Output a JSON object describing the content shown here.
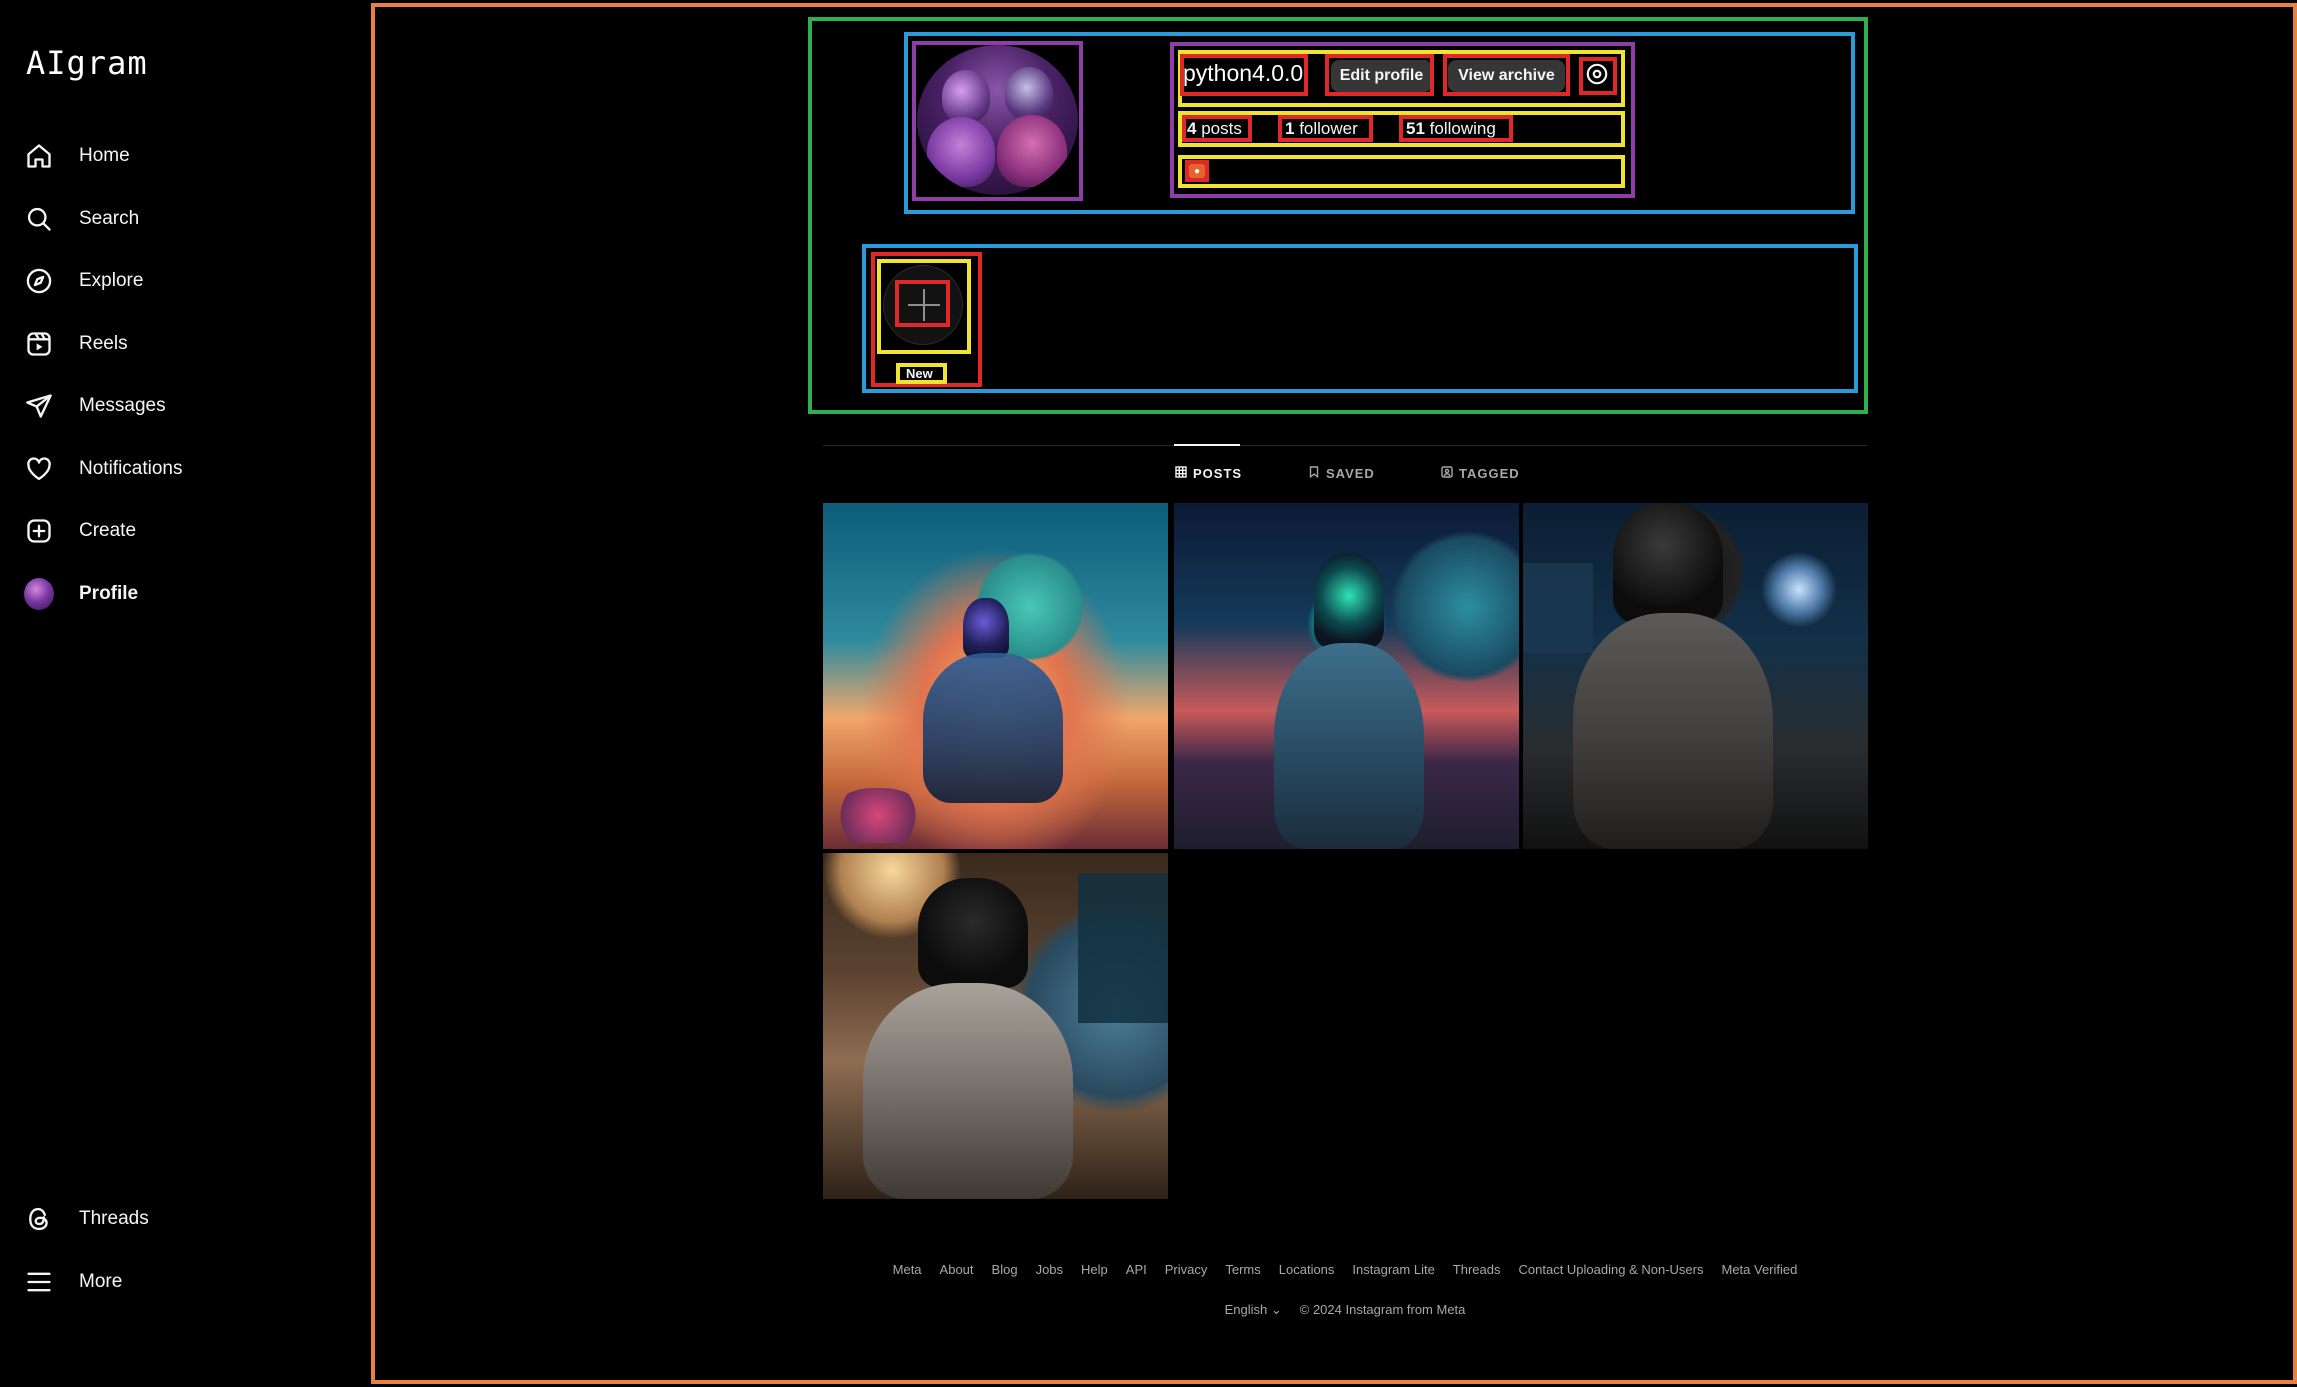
{
  "app": {
    "logo": "AIgram"
  },
  "sidebar": {
    "items": [
      {
        "label": "Home",
        "icon": "home-icon"
      },
      {
        "label": "Search",
        "icon": "search-icon"
      },
      {
        "label": "Explore",
        "icon": "compass-icon"
      },
      {
        "label": "Reels",
        "icon": "reels-icon"
      },
      {
        "label": "Messages",
        "icon": "send-icon"
      },
      {
        "label": "Notifications",
        "icon": "heart-icon"
      },
      {
        "label": "Create",
        "icon": "plus-square-icon"
      },
      {
        "label": "Profile",
        "icon": "avatar"
      }
    ],
    "bottom": [
      {
        "label": "Threads",
        "icon": "threads-icon"
      },
      {
        "label": "More",
        "icon": "menu-icon"
      }
    ]
  },
  "profile": {
    "username": "python4.0.0",
    "edit_label": "Edit profile",
    "archive_label": "View archive",
    "stats": {
      "posts_count": "4",
      "posts_label": "posts",
      "followers_count": "1",
      "followers_label": "follower",
      "following_count": "51",
      "following_label": "following"
    }
  },
  "highlights": {
    "new_label": "New"
  },
  "tabs": [
    {
      "label": "POSTS",
      "icon": "grid-icon",
      "active": true
    },
    {
      "label": "SAVED",
      "icon": "bookmark-icon",
      "active": false
    },
    {
      "label": "TAGGED",
      "icon": "tag-icon",
      "active": false
    }
  ],
  "footer": {
    "links": [
      "Meta",
      "About",
      "Blog",
      "Jobs",
      "Help",
      "API",
      "Privacy",
      "Terms",
      "Locations",
      "Instagram Lite",
      "Threads",
      "Contact Uploading & Non-Users",
      "Meta Verified"
    ],
    "language": "English",
    "copyright": "© 2024 Instagram from Meta"
  },
  "colors": {
    "background": "#000000",
    "button": "#363636",
    "text": "#f5f5f5",
    "muted": "#a8a8a8"
  }
}
